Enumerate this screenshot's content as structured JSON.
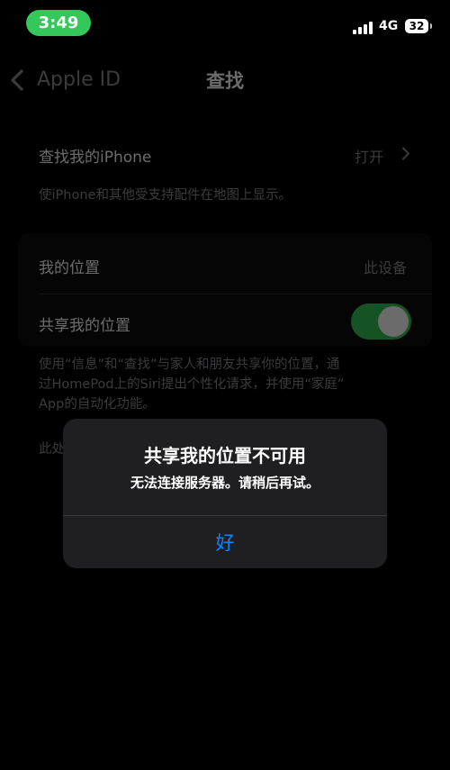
{
  "status_bar": {
    "time": "3:49",
    "network": "4G",
    "battery": "32"
  },
  "nav": {
    "back_label": "Apple ID",
    "title": "查找"
  },
  "find_my_iphone": {
    "label": "查找我的iPhone",
    "value": "打开",
    "footnote": "使iPhone和其他受支持配件在地图上显示。"
  },
  "my_location": {
    "label": "我的位置",
    "value": "此设备"
  },
  "share_location": {
    "label": "共享我的位置",
    "enabled": true,
    "footnote_lines": [
      "使用“信息”和“查找”与家人和朋友共享你的位置，通",
      "过HomePod上的Siri提出个性化请求，并使用“家庭”",
      "App的自动化功能。"
    ]
  },
  "partial_text": "此处",
  "alert": {
    "title": "共享我的位置不可用",
    "message": "无法连接服务器。请稍后再试。",
    "button_label": "好"
  },
  "colors": {
    "toggle_on": "#34c759",
    "time_pill": "#34c759",
    "link_blue": "#0a84ff",
    "background": "#000000"
  }
}
